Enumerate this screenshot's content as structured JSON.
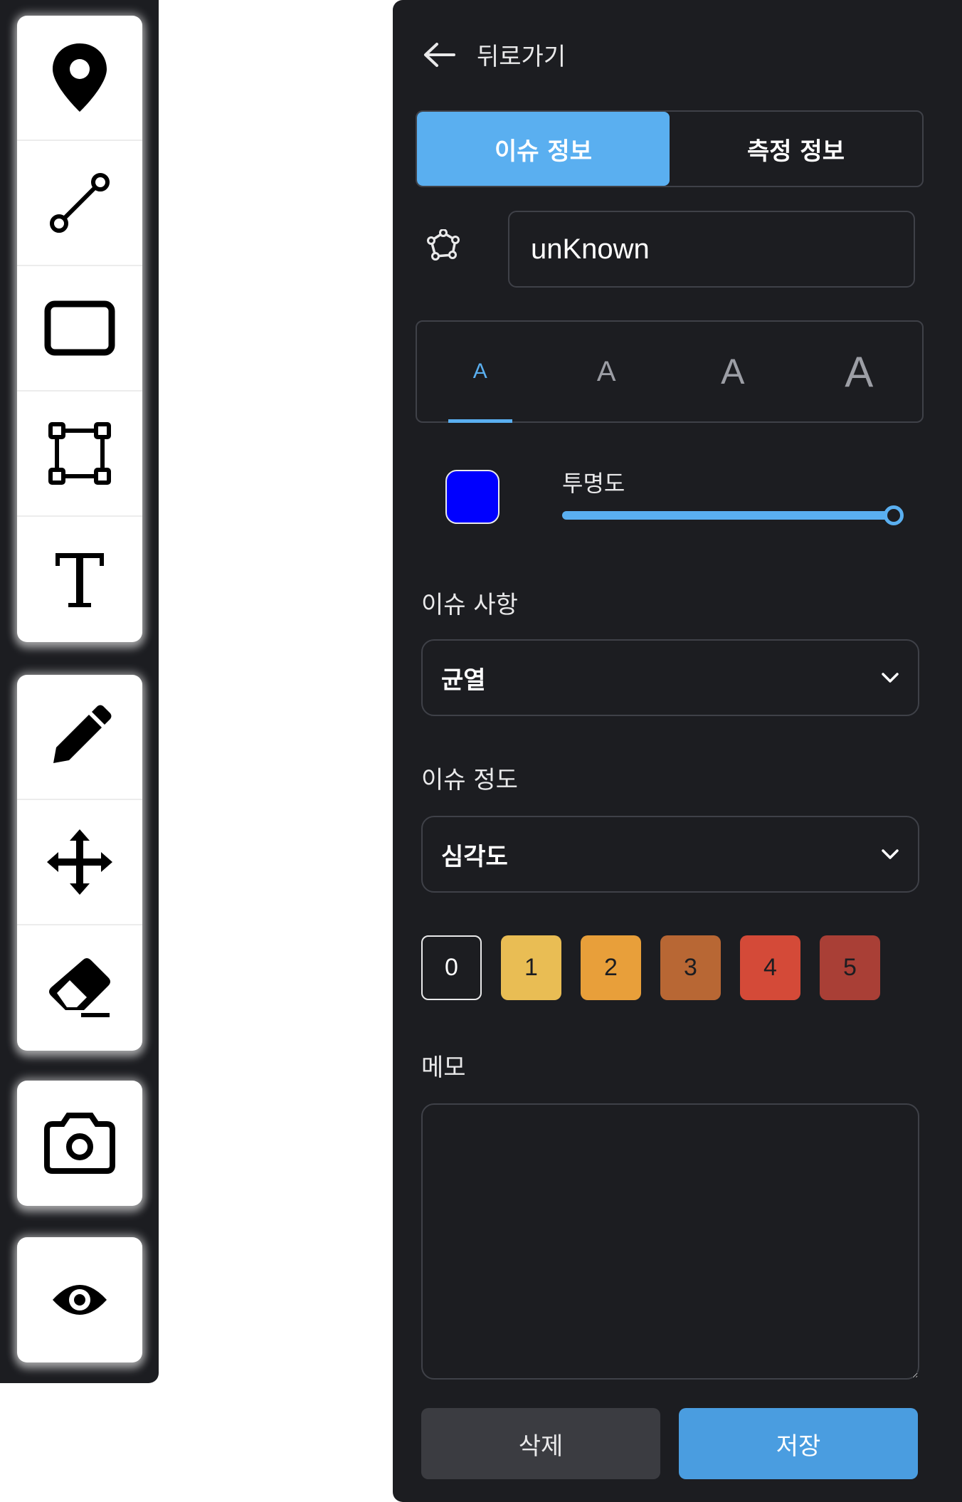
{
  "toolbar": {
    "group1": [
      {
        "icon": "map-pin-icon",
        "tool": "point"
      },
      {
        "icon": "line-segment-icon",
        "tool": "line"
      },
      {
        "icon": "rectangle-icon",
        "tool": "rectangle"
      },
      {
        "icon": "polygon-icon",
        "tool": "polygon"
      },
      {
        "icon": "text-icon",
        "tool": "text"
      }
    ],
    "group2": [
      {
        "icon": "pencil-icon",
        "tool": "draw"
      },
      {
        "icon": "move-icon",
        "tool": "move"
      },
      {
        "icon": "eraser-icon",
        "tool": "erase"
      }
    ],
    "group3": [
      {
        "icon": "camera-icon",
        "tool": "capture"
      }
    ],
    "group4": [
      {
        "icon": "eye-icon",
        "tool": "visibility"
      }
    ]
  },
  "panel": {
    "back_label": "뒤로가기",
    "tabs": [
      {
        "label": "이슈 정보",
        "active": true
      },
      {
        "label": "측정 정보",
        "active": false
      }
    ],
    "name_value": "unKnown",
    "font_sizes": [
      {
        "label": "A",
        "active": true
      },
      {
        "label": "A",
        "active": false
      },
      {
        "label": "A",
        "active": false
      },
      {
        "label": "A",
        "active": false
      }
    ],
    "color": "#0000ff",
    "opacity_label": "투명도",
    "opacity_value": 1.0,
    "issue_label": "이슈 사항",
    "issue_value": "균열",
    "severity_label": "이슈 정도",
    "severity_value": "심각도",
    "levels": [
      {
        "label": "0",
        "color": "transparent"
      },
      {
        "label": "1",
        "color": "#e9bd54"
      },
      {
        "label": "2",
        "color": "#e89f3a"
      },
      {
        "label": "3",
        "color": "#b86734"
      },
      {
        "label": "4",
        "color": "#d44a38"
      },
      {
        "label": "5",
        "color": "#a93f36"
      }
    ],
    "memo_label": "메모",
    "memo_value": "",
    "delete_label": "삭제",
    "save_label": "저장"
  }
}
